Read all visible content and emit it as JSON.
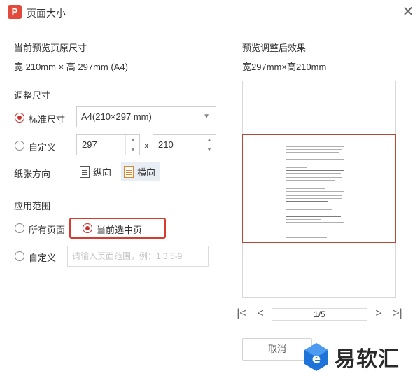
{
  "window": {
    "title": "页面大小",
    "logo_letter": "P",
    "close_symbol": "✕"
  },
  "left": {
    "current_size_title": "当前预览页原尺寸",
    "current_size_value": "宽 210mm × 高 297mm (A4)",
    "adjust_title": "调整尺寸",
    "standard_label": "标准尺寸",
    "standard_selected": "A4(210×297 mm)",
    "custom_label": "自定义",
    "width_value": "297",
    "times": "x",
    "height_value": "210",
    "orientation_label": "纸张方向",
    "portrait_label": "纵向",
    "landscape_label": "横向",
    "apply_title": "应用范围",
    "all_pages_label": "所有页面",
    "current_page_label": "当前选中页",
    "custom_range_label": "自定义",
    "range_placeholder": "请输入页面范围，例：1,3,5-9"
  },
  "right": {
    "preview_title": "预览调整后效果",
    "preview_size": "宽297mm×高210mm",
    "page_indicator": "1/5",
    "first_symbol": "|<",
    "prev_symbol": "<",
    "next_symbol": ">",
    "last_symbol": ">|"
  },
  "footer": {
    "cancel_label": "取消"
  },
  "watermark": {
    "text": "易软汇"
  },
  "colors": {
    "accent": "#c9302c",
    "highlight": "#d63b30",
    "watermark_blue": "#1e73d8"
  }
}
